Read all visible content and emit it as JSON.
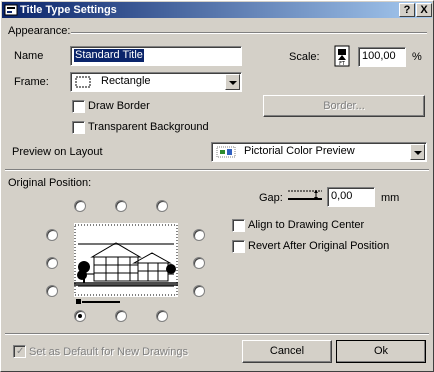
{
  "window": {
    "title": "Title Type Settings",
    "help_label": "?",
    "close_label": "X"
  },
  "appearance": {
    "section_label": "Appearance:",
    "name_label": "Name",
    "name_value": "Standard Title",
    "scale_label": "Scale:",
    "scale_value": "100,00",
    "scale_unit": "%",
    "frame_label": "Frame:",
    "frame_value": "Rectangle",
    "draw_border_label": "Draw Border",
    "draw_border_checked": false,
    "border_button_label": "Border...",
    "transparent_bg_label": "Transparent Background",
    "transparent_bg_checked": false,
    "preview_label": "Preview on Layout",
    "preview_value": "Pictorial Color Preview"
  },
  "origin": {
    "section_label": "Original Position:",
    "gap_label": "Gap:",
    "gap_value": "0,00",
    "gap_unit": "mm",
    "align_label": "Align to Drawing Center",
    "align_checked": false,
    "revert_label": "Revert After Original Position",
    "revert_checked": false,
    "selected_anchor": "bottom-left"
  },
  "footer": {
    "default_label": "Set as Default for New Drawings",
    "default_checked": true,
    "cancel_label": "Cancel",
    "ok_label": "Ok"
  }
}
